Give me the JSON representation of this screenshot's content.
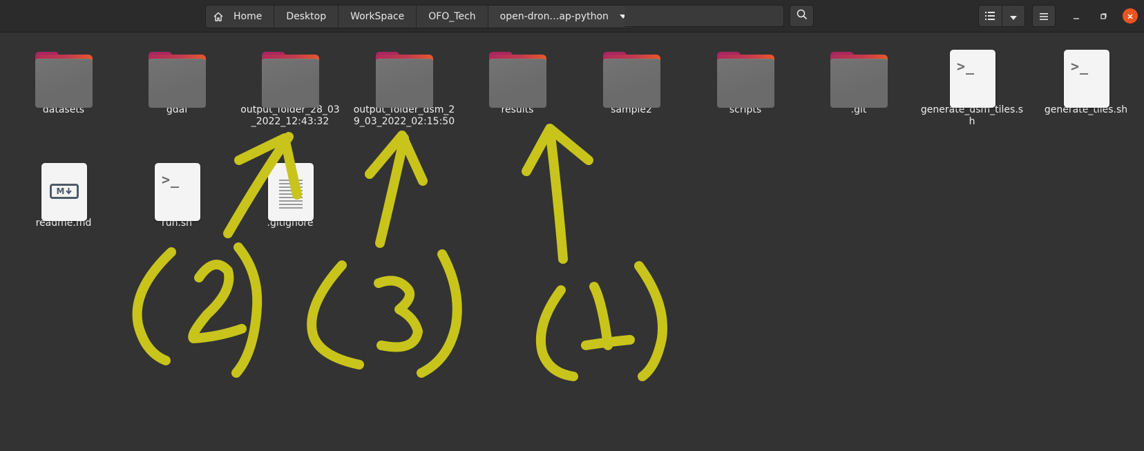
{
  "header": {
    "breadcrumbs": [
      {
        "label": "Home",
        "icon": "home-icon"
      },
      {
        "label": "Desktop"
      },
      {
        "label": "WorkSpace"
      },
      {
        "label": "OFO_Tech"
      },
      {
        "label": "open-dron…ap-python",
        "icon": "chevron-down-icon"
      }
    ],
    "buttons": [
      "search-icon",
      "list-view-icon",
      "view-options-chevron-icon",
      "hamburger-menu-icon",
      "minimize-icon",
      "maximize-icon",
      "close-icon"
    ]
  },
  "files": [
    {
      "name": "datasets",
      "type": "folder"
    },
    {
      "name": "gdal",
      "type": "folder"
    },
    {
      "name": "output_folder_28_03_2022_12:43:32",
      "type": "folder"
    },
    {
      "name": "output_folder_dsm_29_03_2022_02:15:50",
      "type": "folder"
    },
    {
      "name": "results",
      "type": "folder"
    },
    {
      "name": "sample2",
      "type": "folder"
    },
    {
      "name": "scripts",
      "type": "folder"
    },
    {
      "name": ".git",
      "type": "folder"
    },
    {
      "name": "generate_dsm_tiles.sh",
      "type": "script"
    },
    {
      "name": "generate_tiles.sh",
      "type": "script"
    },
    {
      "name": "readme.md",
      "type": "markdown"
    },
    {
      "name": "run.sh",
      "type": "script"
    },
    {
      "name": ".gitignore",
      "type": "text"
    }
  ],
  "annotations": {
    "color": "#c8c41c",
    "labels": [
      "(2)",
      "(3)",
      "(1)"
    ]
  },
  "colors": {
    "background": "#333333",
    "headerbar": "#2b2b2b",
    "accent": "#e95420"
  }
}
